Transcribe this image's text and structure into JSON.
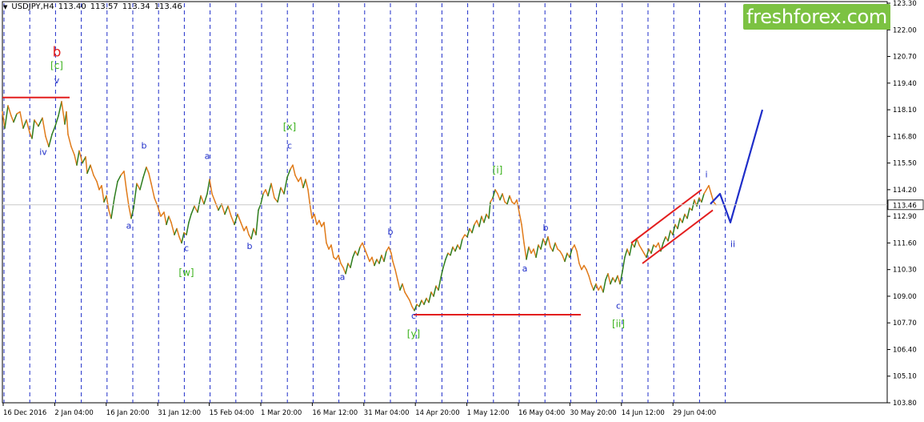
{
  "header": {
    "symbol": "USDJPY,H4",
    "open": "113.40",
    "high": "113.57",
    "low": "113.34",
    "close": "113.46"
  },
  "brand": {
    "text": "freshforex.com"
  },
  "colors": {
    "background": "#ffffff",
    "candle": "#e07b1a",
    "trend_up": "#2e7d1e",
    "support_lines": "#e31e1e",
    "projection": "#1f2ec9",
    "grid": "#1f2ec9",
    "brand": "#7cc242",
    "label_blue": "#1f2ec9",
    "label_green": "#3cb21e",
    "label_red": "#e31e1e"
  },
  "chart_data": {
    "type": "line",
    "instrument": "USDJPY",
    "timeframe": "H4",
    "ylim": [
      103.8,
      123.3
    ],
    "y_ticks": [
      "123.30",
      "122.00",
      "120.70",
      "119.40",
      "118.10",
      "116.80",
      "115.50",
      "114.20",
      "112.90",
      "111.60",
      "110.30",
      "109.00",
      "107.70",
      "106.40",
      "105.10",
      "103.80"
    ],
    "last_price": "113.46",
    "x_ticks": [
      "16 Dec 2016",
      "2 Jan 04:00",
      "16 Jan 20:00",
      "31 Jan 12:00",
      "15 Feb 04:00",
      "1 Mar 20:00",
      "16 Mar 12:00",
      "31 Mar 04:00",
      "14 Apr 20:00",
      "1 May 12:00",
      "16 May 04:00",
      "30 May 20:00",
      "14 Jun 12:00",
      "29 Jun 04:00"
    ],
    "grid": "vertical dashed",
    "price_path": [
      [
        0,
        118.0
      ],
      [
        3,
        117.2
      ],
      [
        7,
        118.3
      ],
      [
        11,
        117.8
      ],
      [
        14,
        117.5
      ],
      [
        18,
        117.9
      ],
      [
        22,
        118.0
      ],
      [
        26,
        117.2
      ],
      [
        30,
        117.6
      ],
      [
        34,
        117.0
      ],
      [
        37,
        116.7
      ],
      [
        40,
        117.6
      ],
      [
        45,
        117.3
      ],
      [
        50,
        117.7
      ],
      [
        54,
        116.8
      ],
      [
        58,
        116.3
      ],
      [
        62,
        116.9
      ],
      [
        66,
        117.3
      ],
      [
        70,
        117.8
      ],
      [
        74,
        118.5
      ],
      [
        78,
        117.4
      ],
      [
        80,
        118.0
      ],
      [
        82,
        116.9
      ],
      [
        86,
        116.3
      ],
      [
        90,
        115.9
      ],
      [
        93,
        115.4
      ],
      [
        96,
        116.1
      ],
      [
        100,
        115.5
      ],
      [
        104,
        115.8
      ],
      [
        106,
        115.0
      ],
      [
        110,
        115.4
      ],
      [
        114,
        114.9
      ],
      [
        118,
        114.6
      ],
      [
        121,
        114.2
      ],
      [
        124,
        114.4
      ],
      [
        127,
        113.6
      ],
      [
        130,
        113.9
      ],
      [
        133,
        113.2
      ],
      [
        136,
        112.8
      ],
      [
        140,
        113.8
      ],
      [
        144,
        114.6
      ],
      [
        148,
        114.9
      ],
      [
        152,
        115.1
      ],
      [
        155,
        114.2
      ],
      [
        158,
        113.4
      ],
      [
        161,
        112.8
      ],
      [
        164,
        113.3
      ],
      [
        168,
        114.5
      ],
      [
        172,
        114.2
      ],
      [
        176,
        114.8
      ],
      [
        180,
        115.3
      ],
      [
        183,
        115.0
      ],
      [
        186,
        114.5
      ],
      [
        190,
        113.8
      ],
      [
        194,
        113.4
      ],
      [
        198,
        112.9
      ],
      [
        202,
        113.1
      ],
      [
        205,
        112.5
      ],
      [
        208,
        112.9
      ],
      [
        211,
        112.6
      ],
      [
        215,
        112.0
      ],
      [
        218,
        112.3
      ],
      [
        221,
        111.9
      ],
      [
        224,
        111.6
      ],
      [
        227,
        112.1
      ],
      [
        230,
        112.0
      ],
      [
        233,
        112.6
      ],
      [
        236,
        113.0
      ],
      [
        240,
        113.4
      ],
      [
        244,
        113.1
      ],
      [
        248,
        113.9
      ],
      [
        252,
        113.5
      ],
      [
        256,
        114.0
      ],
      [
        259,
        114.7
      ],
      [
        262,
        114.0
      ],
      [
        266,
        113.6
      ],
      [
        270,
        113.2
      ],
      [
        274,
        113.5
      ],
      [
        278,
        113.0
      ],
      [
        282,
        113.4
      ],
      [
        286,
        112.9
      ],
      [
        290,
        112.5
      ],
      [
        294,
        113.0
      ],
      [
        298,
        112.6
      ],
      [
        302,
        112.2
      ],
      [
        305,
        112.4
      ],
      [
        308,
        112.0
      ],
      [
        311,
        111.8
      ],
      [
        314,
        112.3
      ],
      [
        317,
        112.0
      ],
      [
        320,
        113.2
      ],
      [
        323,
        113.5
      ],
      [
        326,
        114.0
      ],
      [
        329,
        114.2
      ],
      [
        332,
        113.9
      ],
      [
        336,
        114.5
      ],
      [
        340,
        113.8
      ],
      [
        344,
        113.6
      ],
      [
        348,
        114.3
      ],
      [
        352,
        114.0
      ],
      [
        356,
        114.8
      ],
      [
        360,
        115.2
      ],
      [
        363,
        115.4
      ],
      [
        366,
        114.9
      ],
      [
        370,
        114.6
      ],
      [
        373,
        114.8
      ],
      [
        376,
        114.3
      ],
      [
        379,
        114.7
      ],
      [
        382,
        114.2
      ],
      [
        384,
        113.6
      ],
      [
        387,
        112.8
      ],
      [
        390,
        113.0
      ],
      [
        393,
        112.5
      ],
      [
        396,
        112.7
      ],
      [
        399,
        112.4
      ],
      [
        402,
        112.6
      ],
      [
        405,
        111.6
      ],
      [
        408,
        111.3
      ],
      [
        411,
        111.5
      ],
      [
        414,
        110.9
      ],
      [
        417,
        110.8
      ],
      [
        420,
        111.0
      ],
      [
        423,
        110.6
      ],
      [
        426,
        110.4
      ],
      [
        429,
        110.1
      ],
      [
        432,
        110.6
      ],
      [
        435,
        110.4
      ],
      [
        438,
        110.9
      ],
      [
        441,
        111.2
      ],
      [
        444,
        111.0
      ],
      [
        447,
        111.4
      ],
      [
        450,
        111.6
      ],
      [
        453,
        111.3
      ],
      [
        456,
        111.0
      ],
      [
        459,
        110.7
      ],
      [
        462,
        110.9
      ],
      [
        465,
        110.5
      ],
      [
        468,
        110.8
      ],
      [
        471,
        110.6
      ],
      [
        474,
        111.0
      ],
      [
        477,
        110.7
      ],
      [
        480,
        111.2
      ],
      [
        483,
        111.4
      ],
      [
        486,
        111.1
      ],
      [
        488,
        110.7
      ],
      [
        491,
        110.3
      ],
      [
        494,
        109.8
      ],
      [
        497,
        109.3
      ],
      [
        500,
        109.6
      ],
      [
        503,
        109.2
      ],
      [
        506,
        109.0
      ],
      [
        509,
        108.8
      ],
      [
        512,
        108.5
      ],
      [
        515,
        108.3
      ],
      [
        518,
        108.6
      ],
      [
        521,
        108.5
      ],
      [
        524,
        108.8
      ],
      [
        527,
        108.6
      ],
      [
        530,
        108.9
      ],
      [
        533,
        108.7
      ],
      [
        536,
        109.2
      ],
      [
        539,
        109.0
      ],
      [
        542,
        109.5
      ],
      [
        545,
        109.3
      ],
      [
        548,
        109.9
      ],
      [
        551,
        110.4
      ],
      [
        554,
        110.8
      ],
      [
        557,
        111.1
      ],
      [
        560,
        111.0
      ],
      [
        563,
        111.4
      ],
      [
        566,
        111.2
      ],
      [
        569,
        111.5
      ],
      [
        572,
        111.3
      ],
      [
        575,
        111.8
      ],
      [
        578,
        112.0
      ],
      [
        581,
        111.9
      ],
      [
        584,
        112.3
      ],
      [
        587,
        112.1
      ],
      [
        590,
        112.5
      ],
      [
        593,
        112.7
      ],
      [
        596,
        112.4
      ],
      [
        599,
        112.9
      ],
      [
        602,
        112.6
      ],
      [
        605,
        113.0
      ],
      [
        608,
        112.8
      ],
      [
        610,
        113.6
      ],
      [
        613,
        113.8
      ],
      [
        616,
        114.2
      ],
      [
        619,
        114.0
      ],
      [
        622,
        113.7
      ],
      [
        625,
        114.0
      ],
      [
        628,
        113.6
      ],
      [
        631,
        113.5
      ],
      [
        634,
        113.9
      ],
      [
        637,
        113.6
      ],
      [
        640,
        113.5
      ],
      [
        643,
        113.7
      ],
      [
        646,
        113.1
      ],
      [
        649,
        112.5
      ],
      [
        652,
        111.6
      ],
      [
        655,
        110.8
      ],
      [
        658,
        111.4
      ],
      [
        661,
        111.1
      ],
      [
        664,
        111.3
      ],
      [
        667,
        110.9
      ],
      [
        670,
        111.5
      ],
      [
        673,
        111.3
      ],
      [
        676,
        111.8
      ],
      [
        679,
        111.5
      ],
      [
        682,
        111.9
      ],
      [
        685,
        111.4
      ],
      [
        688,
        111.2
      ],
      [
        691,
        111.6
      ],
      [
        694,
        111.3
      ],
      [
        697,
        111.2
      ],
      [
        700,
        111.0
      ],
      [
        703,
        110.7
      ],
      [
        706,
        111.1
      ],
      [
        709,
        110.9
      ],
      [
        712,
        111.3
      ],
      [
        715,
        111.5
      ],
      [
        718,
        111.2
      ],
      [
        721,
        110.6
      ],
      [
        724,
        110.3
      ],
      [
        727,
        110.5
      ],
      [
        730,
        110.3
      ],
      [
        733,
        110.0
      ],
      [
        736,
        109.6
      ],
      [
        739,
        109.3
      ],
      [
        742,
        109.6
      ],
      [
        745,
        109.3
      ],
      [
        748,
        109.5
      ],
      [
        751,
        109.2
      ],
      [
        754,
        109.8
      ],
      [
        757,
        110.1
      ],
      [
        760,
        109.6
      ],
      [
        763,
        109.9
      ],
      [
        766,
        109.7
      ],
      [
        769,
        110.0
      ],
      [
        772,
        109.6
      ],
      [
        775,
        110.2
      ],
      [
        778,
        110.9
      ],
      [
        781,
        111.3
      ],
      [
        784,
        111.0
      ],
      [
        787,
        111.6
      ],
      [
        790,
        111.4
      ],
      [
        793,
        111.8
      ],
      [
        796,
        111.5
      ],
      [
        799,
        111.3
      ],
      [
        802,
        111.1
      ],
      [
        805,
        110.9
      ],
      [
        808,
        111.3
      ],
      [
        811,
        111.1
      ],
      [
        814,
        111.5
      ],
      [
        817,
        111.4
      ],
      [
        820,
        111.6
      ],
      [
        823,
        111.2
      ],
      [
        826,
        111.6
      ],
      [
        829,
        111.9
      ],
      [
        832,
        111.7
      ],
      [
        835,
        112.2
      ],
      [
        838,
        112.0
      ],
      [
        841,
        112.5
      ],
      [
        844,
        112.3
      ],
      [
        847,
        112.8
      ],
      [
        850,
        112.6
      ],
      [
        853,
        113.0
      ],
      [
        856,
        112.8
      ],
      [
        859,
        113.3
      ],
      [
        862,
        113.2
      ],
      [
        865,
        113.7
      ],
      [
        868,
        113.4
      ],
      [
        871,
        113.8
      ],
      [
        874,
        113.6
      ],
      [
        877,
        114.0
      ],
      [
        880,
        114.2
      ],
      [
        883,
        114.4
      ],
      [
        886,
        114.0
      ],
      [
        889,
        113.6
      ],
      [
        892,
        113.46
      ]
    ],
    "annotations": [
      {
        "text": "b",
        "color": "label_red",
        "size": 17,
        "at": [
          71,
          120.7
        ]
      },
      {
        "text": "[c]",
        "color": "label_green",
        "size": 12,
        "at": [
          71,
          120.1
        ]
      },
      {
        "text": "v",
        "color": "label_blue",
        "size": 11,
        "at": [
          71,
          119.4
        ]
      },
      {
        "text": "iv",
        "color": "label_blue",
        "size": 11,
        "at": [
          54,
          115.9
        ]
      },
      {
        "text": "b",
        "color": "label_blue",
        "size": 11,
        "at": [
          180,
          116.2
        ]
      },
      {
        "text": "a",
        "color": "label_blue",
        "size": 11,
        "at": [
          161,
          112.3
        ]
      },
      {
        "text": "c",
        "color": "label_blue",
        "size": 11,
        "at": [
          233,
          111.2
        ]
      },
      {
        "text": "[w]",
        "color": "label_green",
        "size": 12,
        "at": [
          233,
          110.0
        ]
      },
      {
        "text": "a",
        "color": "label_blue",
        "size": 11,
        "at": [
          259,
          115.7
        ]
      },
      {
        "text": "b",
        "color": "label_blue",
        "size": 11,
        "at": [
          312,
          111.3
        ]
      },
      {
        "text": "[x]",
        "color": "label_green",
        "size": 12,
        "at": [
          362,
          117.1
        ]
      },
      {
        "text": "c",
        "color": "label_blue",
        "size": 11,
        "at": [
          362,
          116.2
        ]
      },
      {
        "text": "a",
        "color": "label_blue",
        "size": 11,
        "at": [
          428,
          109.8
        ]
      },
      {
        "text": "b",
        "color": "label_blue",
        "size": 11,
        "at": [
          488,
          112.0
        ]
      },
      {
        "text": "c",
        "color": "label_blue",
        "size": 11,
        "at": [
          517,
          107.9
        ]
      },
      {
        "text": "[y]",
        "color": "label_green",
        "size": 12,
        "at": [
          517,
          107.0
        ]
      },
      {
        "text": "[i]",
        "color": "label_green",
        "size": 12,
        "at": [
          622,
          115.0
        ]
      },
      {
        "text": "a",
        "color": "label_blue",
        "size": 11,
        "at": [
          656,
          110.2
        ]
      },
      {
        "text": "b",
        "color": "label_blue",
        "size": 11,
        "at": [
          682,
          112.2
        ]
      },
      {
        "text": "c",
        "color": "label_blue",
        "size": 11,
        "at": [
          773,
          108.4
        ]
      },
      {
        "text": "[ii]",
        "color": "label_green",
        "size": 12,
        "at": [
          773,
          107.5
        ]
      },
      {
        "text": "i",
        "color": "label_blue",
        "size": 11,
        "at": [
          883,
          114.8
        ]
      },
      {
        "text": "ii",
        "color": "label_blue",
        "size": 11,
        "at": [
          916,
          111.4
        ]
      }
    ],
    "support_lines": [
      {
        "from": [
          3,
          118.7
        ],
        "to": [
          87,
          118.7
        ]
      },
      {
        "from": [
          517,
          108.1
        ],
        "to": [
          726,
          108.1
        ]
      }
    ],
    "channel": [
      {
        "from": [
          789,
          111.6
        ],
        "to": [
          877,
          114.2
        ]
      },
      {
        "from": [
          803,
          110.6
        ],
        "to": [
          891,
          113.2
        ]
      }
    ],
    "projection_path": [
      [
        888,
        113.5
      ],
      [
        900,
        114.0
      ],
      [
        913,
        112.6
      ],
      [
        953,
        118.1
      ]
    ]
  }
}
